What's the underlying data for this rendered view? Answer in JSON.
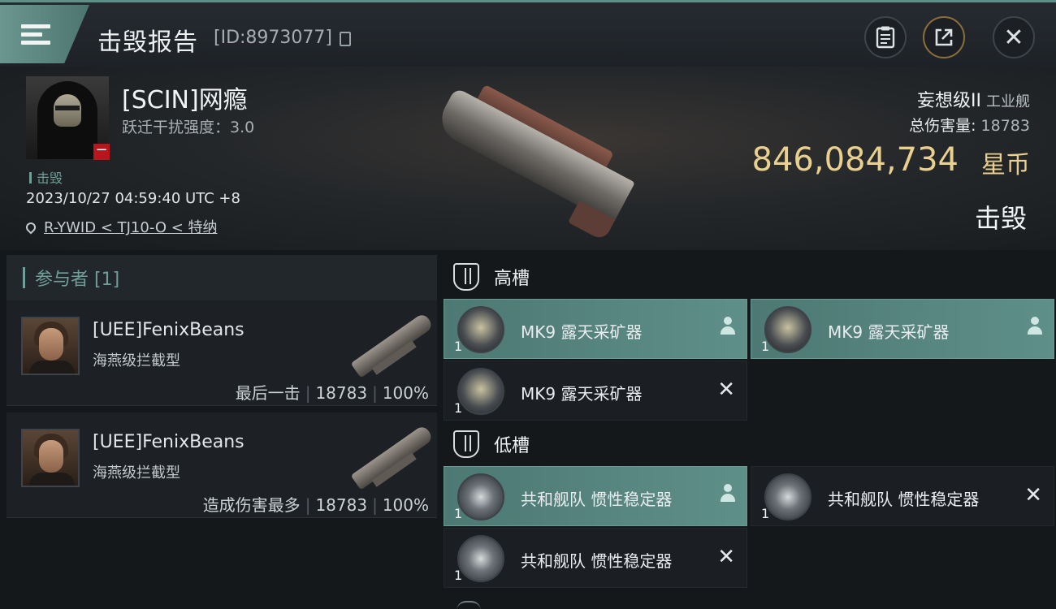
{
  "topbar": {
    "title": "击毁报告",
    "report_id": "[ID:8973077]",
    "buttons": [
      "clipboard",
      "share",
      "close"
    ]
  },
  "victim": {
    "name": "[SCIN]网瘾",
    "warp_scramble": "跃迁干扰强度：3.0",
    "tag": "击毁",
    "time": "2023/10/27 04:59:40 UTC +8",
    "location": "R-YWID < TJ10-O < 特纳",
    "ship_class": "妄想级II",
    "ship_type": "工业舰",
    "total_damage_label": "总伤害量:",
    "total_damage_value": "18783",
    "isk_value": "846,084,734",
    "isk_unit": "星币",
    "status": "击毁"
  },
  "participants": {
    "header": "参与者 [1]",
    "rows": [
      {
        "name": "[UEE]FenixBeans",
        "ship": "海燕级拦截型",
        "role": "最后一击",
        "damage": "18783",
        "percent": "100%"
      },
      {
        "name": "[UEE]FenixBeans",
        "ship": "海燕级拦截型",
        "role": "造成伤害最多",
        "damage": "18783",
        "percent": "100%"
      }
    ]
  },
  "fitting": {
    "high_slot_title": "高槽",
    "low_slot_title": "低槽",
    "high": [
      {
        "name": "MK9 露天采矿器",
        "qty": "1",
        "state": "dropped"
      },
      {
        "name": "MK9 露天采矿器",
        "qty": "1",
        "state": "dropped"
      },
      {
        "name": "MK9 露天采矿器",
        "qty": "1",
        "state": "destroyed"
      }
    ],
    "low": [
      {
        "name": "共和舰队 惯性稳定器",
        "qty": "1",
        "state": "dropped"
      },
      {
        "name": "共和舰队 惯性稳定器",
        "qty": "1",
        "state": "destroyed"
      },
      {
        "name": "共和舰队 惯性稳定器",
        "qty": "1",
        "state": "destroyed"
      }
    ],
    "destroyed_symbol": "✕"
  },
  "colors": {
    "accent": "#5f8f89",
    "isk": "#ead08f",
    "badge_red": "#b8161c"
  }
}
